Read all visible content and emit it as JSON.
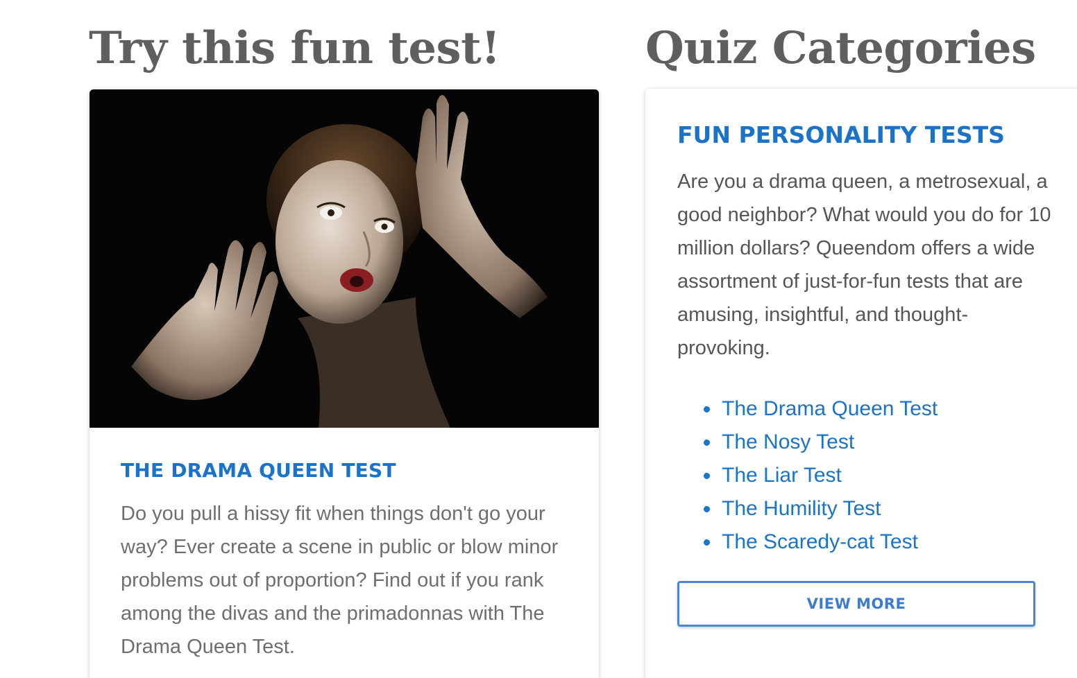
{
  "featured": {
    "heading": "Try this fun test!",
    "image_alt": "Woman with wide eyes and hands raised against a black background",
    "title": "THE DRAMA QUEEN TEST",
    "description": "Do you pull a hissy fit when things don't go your way? Ever create a scene in public or blow minor problems out of proportion? Find out if you rank among the divas and the primadonnas with The Drama Queen Test."
  },
  "categories": {
    "heading": "Quiz Categories",
    "title": "FUN PERSONALITY TESTS",
    "description": "Are you a drama queen, a metrosexual, a good neighbor? What would you do for 10 million dollars? Queendom offers a wide assortment of just-for-fun tests that are amusing, insightful, and thought-provoking.",
    "links": [
      "The Drama Queen Test",
      "The Nosy Test",
      "The Liar Test",
      "The Humility Test",
      "The Scaredy-cat Test"
    ],
    "button_label": "VIEW MORE"
  },
  "colors": {
    "heading": "#5f5f5f",
    "accent": "#1a73c9",
    "button_border": "#4a85d6",
    "body_text": "#6e6e6e"
  }
}
